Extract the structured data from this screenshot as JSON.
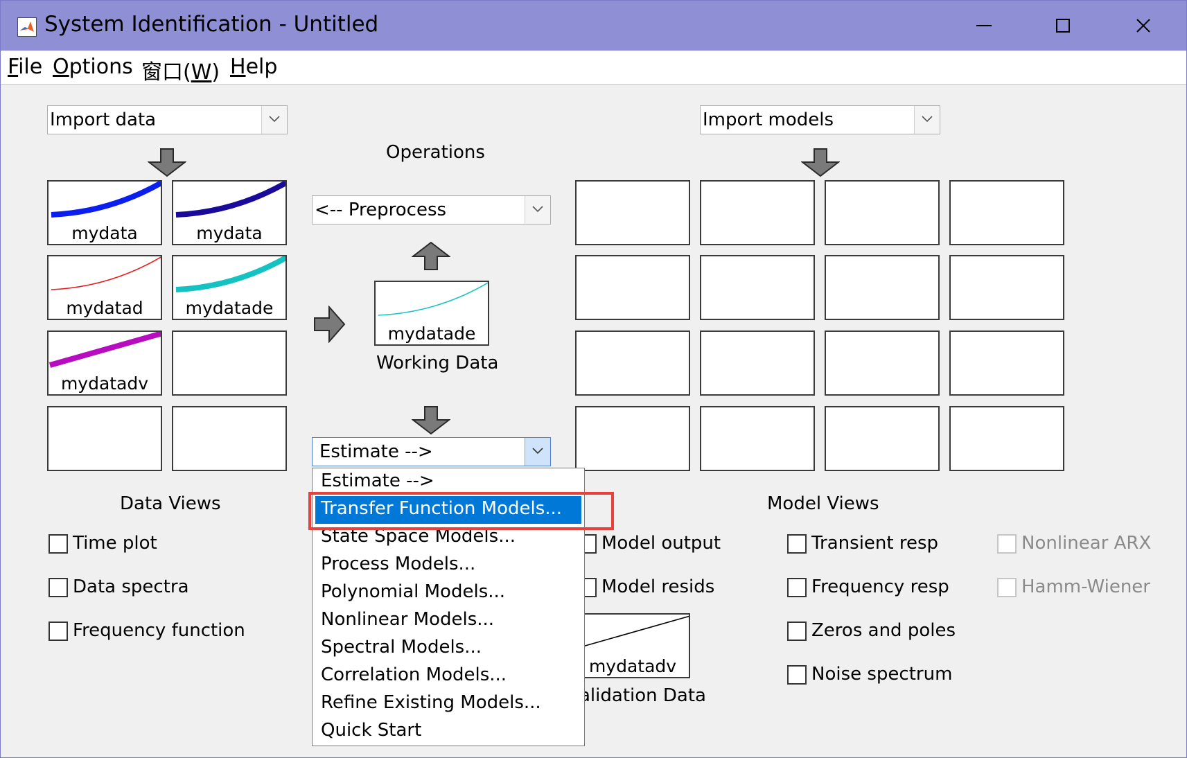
{
  "window": {
    "title": "System Identification - Untitled",
    "icon": "matlab-logo-icon",
    "controls": [
      "minimize-icon",
      "maximize-icon",
      "close-icon"
    ]
  },
  "menubar": {
    "items": [
      {
        "label": "File",
        "mnemonic": "F",
        "rest": "ile"
      },
      {
        "label": "Options",
        "mnemonic": "O",
        "rest": "ptions"
      },
      {
        "label": "窗口(W)",
        "prefix": "窗口(",
        "mnemonic": "W",
        "suffix": ")"
      },
      {
        "label": "Help",
        "mnemonic": "H",
        "rest": "elp"
      }
    ]
  },
  "import_data": {
    "value": "Import data"
  },
  "import_models": {
    "value": "Import models"
  },
  "operations": {
    "label": "Operations",
    "preprocess": "<-- Preprocess",
    "estimate": "Estimate -->",
    "working_data_label": "Working Data",
    "working_data_name": "mydatade",
    "working_data_color": "#19c3c3"
  },
  "data_tiles": [
    {
      "name": "mydata",
      "color": "#0a1ef0",
      "style": "thick-curve"
    },
    {
      "name": "mydata",
      "color": "#1a0a9a",
      "style": "thick-curve"
    },
    {
      "name": "mydatad",
      "color": "#e81c1c",
      "style": "thin-curve"
    },
    {
      "name": "mydatade",
      "color": "#14c2c2",
      "style": "thick-curve"
    },
    {
      "name": "mydatadv",
      "color": "#b80cc0",
      "style": "thick-line"
    },
    {
      "name": "",
      "color": "",
      "style": "empty"
    },
    {
      "name": "",
      "color": "",
      "style": "empty"
    },
    {
      "name": "",
      "color": "",
      "style": "empty"
    }
  ],
  "data_views": {
    "label": "Data Views",
    "checkboxes": [
      {
        "label": "Time plot",
        "checked": false
      },
      {
        "label": "Data spectra",
        "checked": false
      },
      {
        "label": "Frequency function",
        "checked": false
      }
    ]
  },
  "validation": {
    "label_visible": "alidation Data",
    "name": "mydatadv"
  },
  "model_views": {
    "label": "Model Views",
    "checkboxes_col1": [
      {
        "label": "Model output",
        "checked": false
      },
      {
        "label": "Model resids",
        "checked": false
      }
    ],
    "checkboxes_col2": [
      {
        "label": "Transient resp",
        "checked": false
      },
      {
        "label": "Frequency resp",
        "checked": false
      },
      {
        "label": "Zeros and poles",
        "checked": false
      },
      {
        "label": "Noise spectrum",
        "checked": false
      }
    ],
    "checkboxes_col3": [
      {
        "label": "Nonlinear ARX",
        "checked": false,
        "enabled": false
      },
      {
        "label": "Hamm-Wiener",
        "checked": false,
        "enabled": false
      }
    ]
  },
  "estimate_menu": {
    "items": [
      "Estimate -->",
      "Transfer Function Models...",
      "State Space Models...",
      "Process Models...",
      "Polynomial Models...",
      "Nonlinear Models...",
      "Spectral Models...",
      "Correlation Models...",
      "Refine Existing Models...",
      "Quick Start"
    ],
    "selected_index": 1,
    "highlight_color": "#0078d7",
    "callout_color": "#e8403a"
  }
}
